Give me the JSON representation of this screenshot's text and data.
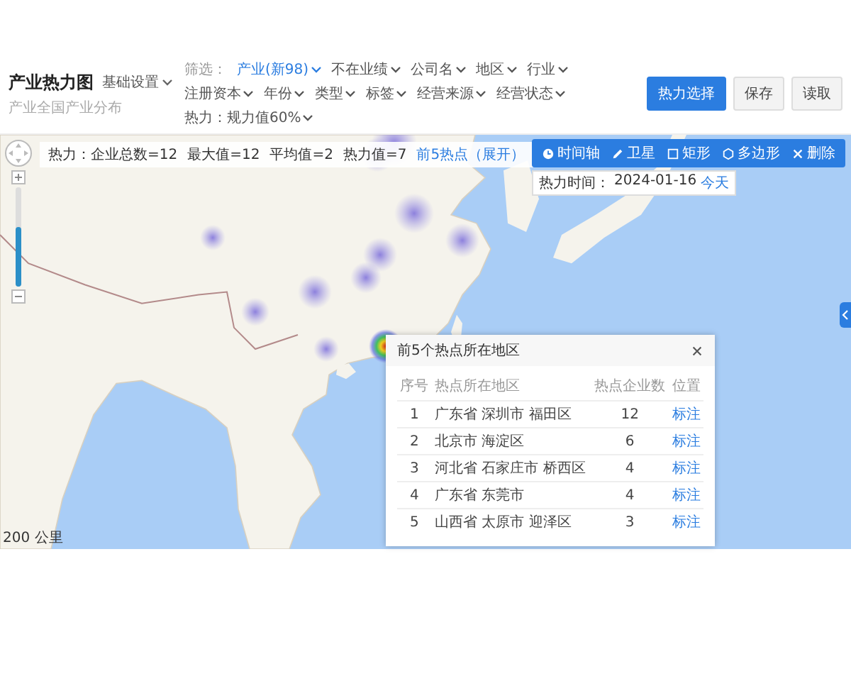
{
  "header": {
    "title": "产业热力图",
    "subtitle": "产业全国产业分布",
    "preset": "基础设置"
  },
  "filters": {
    "label": "筛选：",
    "items": [
      {
        "label": "产业(新98)",
        "active": true
      },
      {
        "label": "不在业绩",
        "active": false
      },
      {
        "label": "公司名",
        "active": false
      },
      {
        "label": "地区",
        "active": false
      },
      {
        "label": "行业",
        "active": false
      },
      {
        "label": "注册资本",
        "active": false
      },
      {
        "label": "年份",
        "active": false
      },
      {
        "label": "类型",
        "active": false
      },
      {
        "label": "标签",
        "active": false
      },
      {
        "label": "经营来源",
        "active": false
      },
      {
        "label": "经营状态",
        "active": false
      },
      {
        "label": "热力：规力值60%",
        "active": false
      }
    ]
  },
  "buttons": [
    {
      "label": "热力选择",
      "primary": true
    },
    {
      "label": "保存",
      "primary": false
    },
    {
      "label": "读取",
      "primary": false
    }
  ],
  "map": {
    "stats": [
      {
        "kind": "text",
        "text": "热力：企业总数=12"
      },
      {
        "kind": "text",
        "text": "最大值=12"
      },
      {
        "kind": "text",
        "text": "平均值=2"
      },
      {
        "kind": "text",
        "text": "热力值=7"
      },
      {
        "kind": "link",
        "text": "前5热点（展开）"
      }
    ],
    "toolbar": [
      {
        "label": "时间轴"
      },
      {
        "label": "卫星"
      },
      {
        "label": "矩形"
      },
      {
        "label": "多边形"
      },
      {
        "label": "删除"
      }
    ],
    "time": {
      "label": "热力时间：",
      "value": "2024-01-16",
      "link": "今天"
    },
    "zoom": {
      "level": 0.6
    },
    "scale": "200 公里",
    "popup": {
      "title": "前5个热点所在地区",
      "columns": [
        "序号",
        "热点所在地区",
        "热点企业数",
        "位置"
      ],
      "rows": [
        {
          "index": "1",
          "region": "广东省 深圳市 福田区",
          "count": "12",
          "action": "标注"
        },
        {
          "index": "2",
          "region": "北京市 海淀区",
          "count": "6",
          "action": "标注"
        },
        {
          "index": "3",
          "region": "河北省 石家庄市 桥西区",
          "count": "4",
          "action": "标注"
        },
        {
          "index": "4",
          "region": "广东省 东莞市",
          "count": "4",
          "action": "标注"
        },
        {
          "index": "5",
          "region": "山西省 太原市 迎泽区",
          "count": "3",
          "action": "标注"
        }
      ]
    }
  }
}
